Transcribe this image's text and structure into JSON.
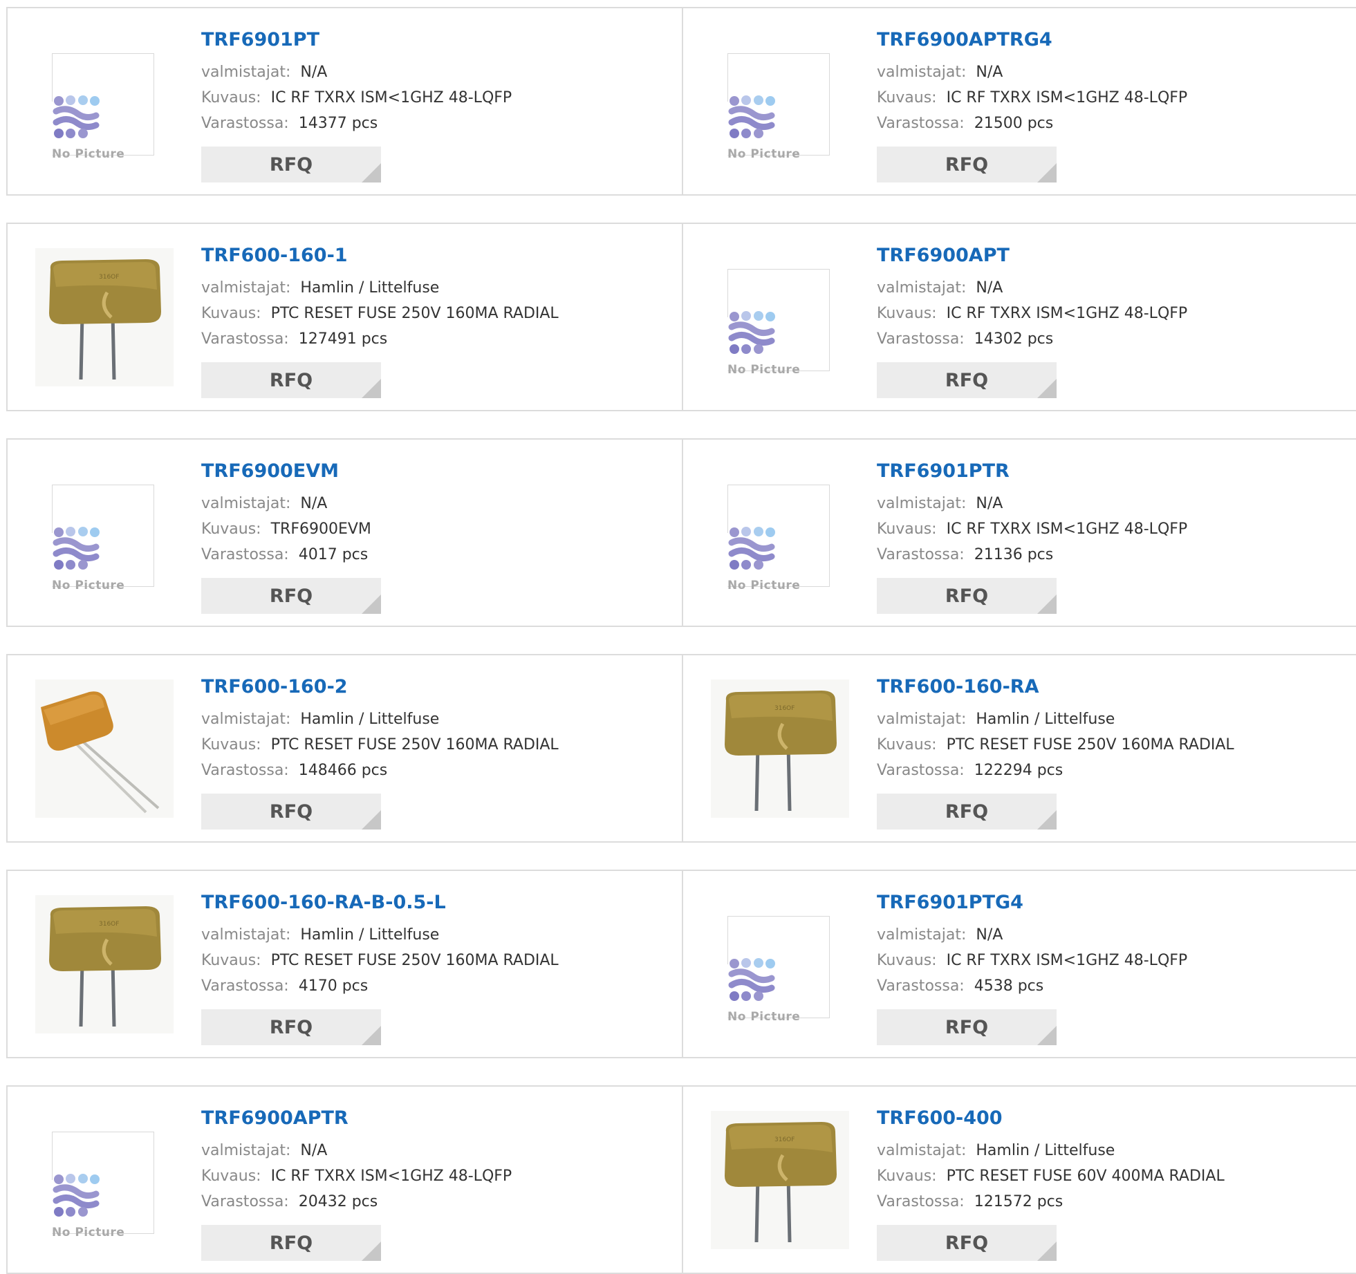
{
  "labels": {
    "manufacturer": "valmistajat:",
    "description": "Kuvaus:",
    "stock": "Varastossa:",
    "rfq": "RFQ",
    "no_picture": "No Picture"
  },
  "colors": {
    "title_link": "#1769b8",
    "label_gray": "#888888",
    "value_dark": "#333333",
    "rfq_bg": "#ececec",
    "border": "#dcdcdc"
  },
  "products": [
    {
      "part": "TRF6901PT",
      "manufacturer": "N/A",
      "description": "IC RF TXRX ISM<1GHZ 48-LQFP",
      "stock": "14377 pcs",
      "image": "no-picture"
    },
    {
      "part": "TRF6900APTRG4",
      "manufacturer": "N/A",
      "description": "IC RF TXRX ISM<1GHZ 48-LQFP",
      "stock": "21500 pcs",
      "image": "no-picture"
    },
    {
      "part": "TRF600-160-1",
      "manufacturer": "Hamlin / Littelfuse",
      "description": "PTC RESET FUSE 250V 160MA RADIAL",
      "stock": "127491 pcs",
      "image": "ptc-fuse-front"
    },
    {
      "part": "TRF6900APT",
      "manufacturer": "N/A",
      "description": "IC RF TXRX ISM<1GHZ 48-LQFP",
      "stock": "14302 pcs",
      "image": "no-picture"
    },
    {
      "part": "TRF6900EVM",
      "manufacturer": "N/A",
      "description": "TRF6900EVM",
      "stock": "4017 pcs",
      "image": "no-picture"
    },
    {
      "part": "TRF6901PTR",
      "manufacturer": "N/A",
      "description": "IC RF TXRX ISM<1GHZ 48-LQFP",
      "stock": "21136 pcs",
      "image": "no-picture"
    },
    {
      "part": "TRF600-160-2",
      "manufacturer": "Hamlin / Littelfuse",
      "description": "PTC RESET FUSE 250V 160MA RADIAL",
      "stock": "148466 pcs",
      "image": "ptc-fuse-angled"
    },
    {
      "part": "TRF600-160-RA",
      "manufacturer": "Hamlin / Littelfuse",
      "description": "PTC RESET FUSE 250V 160MA RADIAL",
      "stock": "122294 pcs",
      "image": "ptc-fuse-front"
    },
    {
      "part": "TRF600-160-RA-B-0.5-L",
      "manufacturer": "Hamlin / Littelfuse",
      "description": "PTC RESET FUSE 250V 160MA RADIAL",
      "stock": "4170 pcs",
      "image": "ptc-fuse-front"
    },
    {
      "part": "TRF6901PTG4",
      "manufacturer": "N/A",
      "description": "IC RF TXRX ISM<1GHZ 48-LQFP",
      "stock": "4538 pcs",
      "image": "no-picture"
    },
    {
      "part": "TRF6900APTR",
      "manufacturer": "N/A",
      "description": "IC RF TXRX ISM<1GHZ 48-LQFP",
      "stock": "20432 pcs",
      "image": "no-picture"
    },
    {
      "part": "TRF600-400",
      "manufacturer": "Hamlin / Littelfuse",
      "description": "PTC RESET FUSE 60V 400MA RADIAL",
      "stock": "121572 pcs",
      "image": "ptc-fuse-front"
    }
  ]
}
